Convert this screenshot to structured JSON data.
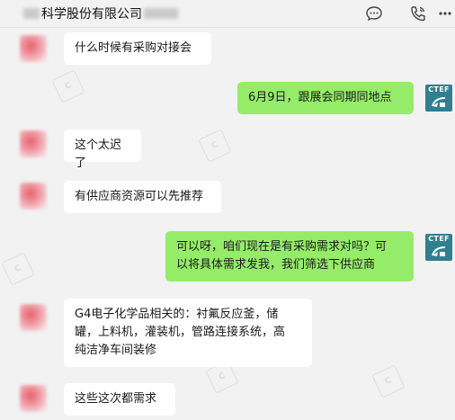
{
  "window": {
    "title": "科学股份有限公司",
    "icons": [
      "chat-bubble-icon",
      "phone-icon",
      "more-icon"
    ]
  },
  "messages": [
    {
      "from": "contact",
      "text": "什么时候有采购对接会"
    },
    {
      "from": "me",
      "text": "6月9日，跟展会同期同地点"
    },
    {
      "from": "contact",
      "text": "这个太迟了"
    },
    {
      "from": "contact",
      "text": "有供应商资源可以先推荐"
    },
    {
      "from": "me",
      "lines": [
        "可以呀，咱们现在是有采购需求对吗？可",
        "以将具体需求发我，我们筛选下供应商"
      ]
    },
    {
      "from": "contact",
      "lines": [
        "G4电子化学品相关的：衬氟反应釜，储",
        "罐，上料机，灌装机，管路连接系统，高",
        "纯洁净车间装修"
      ]
    },
    {
      "from": "contact",
      "text": "这些这次都需求"
    }
  ],
  "avatar": {
    "my_label": "CTEF"
  },
  "colors": {
    "background": "#f2f2f2",
    "bubble_out": "#95ec69",
    "bubble_in": "#ffffff"
  }
}
